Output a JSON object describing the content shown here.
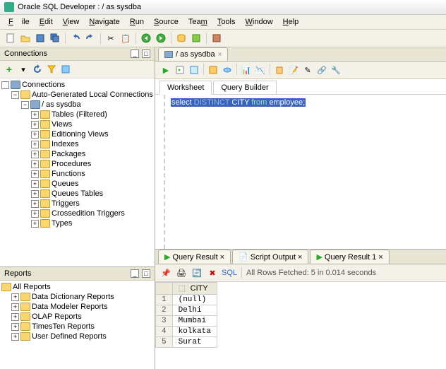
{
  "title": "Oracle SQL Developer : / as sysdba",
  "menu": [
    "File",
    "Edit",
    "View",
    "Navigate",
    "Run",
    "Source",
    "Team",
    "Tools",
    "Window",
    "Help"
  ],
  "connections": {
    "title": "Connections",
    "root": "Connections",
    "group": "Auto-Generated Local Connections",
    "conn": "/ as sysdba",
    "nodes": [
      "Tables (Filtered)",
      "Views",
      "Editioning Views",
      "Indexes",
      "Packages",
      "Procedures",
      "Functions",
      "Queues",
      "Queues Tables",
      "Triggers",
      "Crossedition Triggers",
      "Types"
    ]
  },
  "reports": {
    "title": "Reports",
    "root": "All Reports",
    "items": [
      "Data Dictionary Reports",
      "Data Modeler Reports",
      "OLAP Reports",
      "TimesTen Reports",
      "User Defined Reports"
    ]
  },
  "editor": {
    "tab": "/ as sysdba",
    "subtabs": [
      "Worksheet",
      "Query Builder"
    ],
    "sql_prefix": "select ",
    "sql_kw1": "DISTINCT",
    "sql_mid": " CITY ",
    "sql_kw2": "from",
    "sql_suffix": " employee;"
  },
  "results": {
    "tabs": [
      "Query Result",
      "Script Output",
      "Query Result 1"
    ],
    "sql_label": "SQL",
    "status": "All Rows Fetched: 5 in 0.014 seconds",
    "chart_data": {
      "type": "table",
      "columns": [
        "CITY"
      ],
      "rows": [
        {
          "n": "1",
          "city": "(null)"
        },
        {
          "n": "2",
          "city": "Delhi"
        },
        {
          "n": "3",
          "city": "Mumbai"
        },
        {
          "n": "4",
          "city": "kolkata"
        },
        {
          "n": "5",
          "city": "Surat"
        }
      ]
    }
  }
}
